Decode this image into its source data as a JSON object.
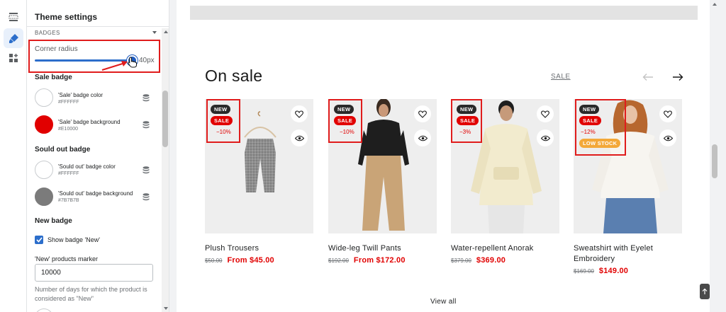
{
  "panel": {
    "title": "Theme settings",
    "section": "BADGES",
    "corner_radius": {
      "label": "Corner radius",
      "value": "40px",
      "fraction": 1.0
    },
    "sale_badge": {
      "title": "Sale badge",
      "color_label": "'Sale' badge color",
      "color_hex": "#FFFFFF",
      "bg_label": "'Sale' badge background",
      "bg_hex": "#E10000"
    },
    "sold_out_badge": {
      "title": "Sould out badge",
      "color_label": "'Sould out' badge color",
      "color_hex": "#FFFFFF",
      "bg_label": "'Sould out' badge background",
      "bg_hex": "#7B7B7B"
    },
    "new_badge": {
      "title": "New badge",
      "show_label": "Show badge 'New'",
      "show_checked": true,
      "marker_label": "'New' products marker",
      "marker_value": "10000",
      "help": "Number of days for which the product is considered as \"New\""
    }
  },
  "preview": {
    "heading": "On sale",
    "link": "SALE",
    "view_all": "View all",
    "products": [
      {
        "title": "Plush Trousers",
        "old_price": "$50.00",
        "new_price": "From $45.00",
        "badges": [
          "NEW",
          "SALE"
        ],
        "discount": "−10%",
        "low_stock": ""
      },
      {
        "title": "Wide-leg Twill Pants",
        "old_price": "$192.00",
        "new_price": "From $172.00",
        "badges": [
          "NEW",
          "SALE"
        ],
        "discount": "−10%",
        "low_stock": ""
      },
      {
        "title": "Water-repellent Anorak",
        "old_price": "$379.00",
        "new_price": "$369.00",
        "badges": [
          "NEW",
          "SALE"
        ],
        "discount": "−3%",
        "low_stock": ""
      },
      {
        "title": "Sweatshirt with Eyelet Embroidery",
        "old_price": "$169.00",
        "new_price": "$149.00",
        "badges": [
          "NEW",
          "SALE"
        ],
        "discount": "−12%",
        "low_stock": "LOW STOCK"
      }
    ]
  },
  "icons": [
    "sections-icon",
    "brush-icon",
    "apps-icon",
    "database-icon",
    "heart-icon",
    "eye-icon",
    "arrow-left-icon",
    "arrow-right-icon",
    "hand-cursor-icon",
    "arrow-up-icon"
  ],
  "colors": {
    "accent": "#2C6ECB",
    "sale": "#E10000",
    "highlight": "#E01C1C",
    "low_stock": "#F3A839"
  }
}
